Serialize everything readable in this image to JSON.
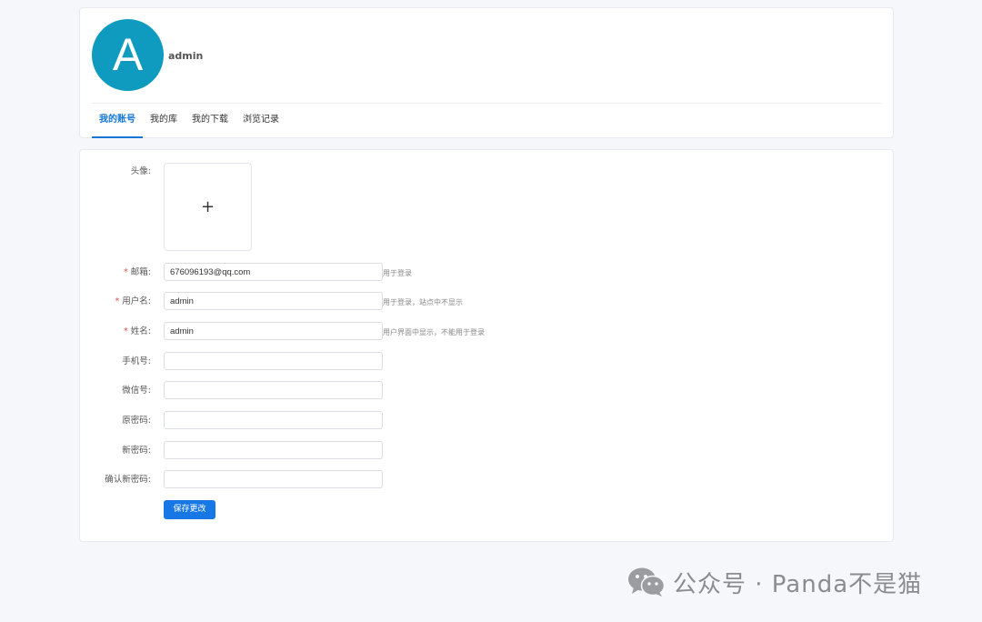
{
  "profile": {
    "avatar_letter": "A",
    "username": "admin",
    "tabs": [
      {
        "label": "我的账号",
        "active": true
      },
      {
        "label": "我的库",
        "active": false
      },
      {
        "label": "我的下载",
        "active": false
      },
      {
        "label": "浏览记录",
        "active": false
      }
    ]
  },
  "form": {
    "avatar_label": "头像:",
    "upload_symbol": "+",
    "required_mark": "*",
    "email": {
      "label": "邮箱:",
      "value": "676096193@qq.com",
      "hint": "用于登录"
    },
    "username": {
      "label": "用户名:",
      "value": "admin",
      "hint": "用于登录，站点中不显示"
    },
    "name": {
      "label": "姓名:",
      "value": "admin",
      "hint": "用户界面中显示，不能用于登录"
    },
    "phone": {
      "label": "手机号:",
      "value": ""
    },
    "wechat": {
      "label": "微信号:",
      "value": ""
    },
    "old_password": {
      "label": "原密码:",
      "value": ""
    },
    "new_password": {
      "label": "新密码:",
      "value": ""
    },
    "confirm_password": {
      "label": "确认新密码:",
      "value": ""
    },
    "save_label": "保存更改"
  },
  "watermark": {
    "icon": "wechat-icon",
    "text": "公众号 · Panda不是猫"
  },
  "colors": {
    "avatar_bg": "#0e9bbf",
    "accent": "#1677e5",
    "required": "#e34d4d"
  }
}
